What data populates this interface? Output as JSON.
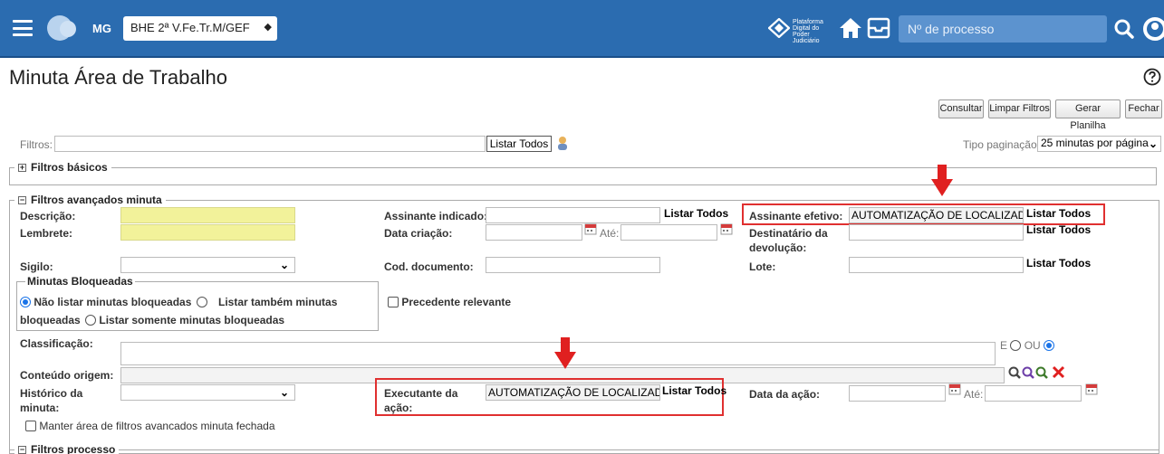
{
  "header": {
    "uf": "MG",
    "orgao_select": "BHE 2ª V.Fe.Tr.M/GEF",
    "logo_text": [
      "Plataforma",
      "Digital do",
      "Poder Judiciário"
    ],
    "search_placeholder": "Nº de processo",
    "icons": [
      "menu-icon",
      "avatar-icon",
      "pdpj-logo-icon",
      "home-icon",
      "inbox-icon",
      "search-icon",
      "user-icon"
    ]
  },
  "page": {
    "title": "Minuta Área de Trabalho"
  },
  "toolbar": {
    "consultar": "Consultar",
    "limpar": "Limpar Filtros",
    "gerar": "Gerar Planilha",
    "fechar": "Fechar"
  },
  "filters": {
    "label": "Filtros:",
    "listar_todos": "Listar Todos",
    "tipo_paginacao_label": "Tipo paginação:",
    "tipo_paginacao_value": "25 minutas por página"
  },
  "basic": {
    "legend": "Filtros básicos"
  },
  "advanced": {
    "legend": "Filtros avançados minuta",
    "descricao": "Descrição:",
    "lembrete": "Lembrete:",
    "sigilo": "Sigilo:",
    "assinante_indicado": "Assinante indicado:",
    "data_criacao": "Data criação:",
    "ate": "Até:",
    "cod_documento": "Cod. documento:",
    "assinante_efetivo": "Assinante efetivo:",
    "assinante_efetivo_value": "AUTOMATIZAÇÃO DE LOCALIZADC",
    "destinatario": "Destinatário da devolução:",
    "lote": "Lote:",
    "listar_todos": "Listar Todos",
    "bloqueadas_legend": "Minutas Bloqueadas",
    "radio_nao_listar": "Não listar minutas bloqueadas",
    "radio_listar_tambem": "Listar também minutas bloqueadas",
    "radio_listar_somente": "Listar somente minutas bloqueadas",
    "precedente": "Precedente relevante",
    "classificacao": "Classificação:",
    "e_label": "E",
    "ou_label": "OU",
    "conteudo_origem": "Conteúdo origem:",
    "historico": "Histórico da minuta:",
    "executante": "Executante da ação:",
    "executante_value": "AUTOMATIZAÇÃO DE LOCALIZADC",
    "data_acao": "Data da ação:",
    "manter": "Manter área de filtros avancados minuta fechada"
  },
  "processo": {
    "legend": "Filtros processo"
  },
  "colors": {
    "header": "#2b6cb0",
    "highlight": "#e03030",
    "yellow_input": "#f2f29a",
    "radio": "#1a73e8"
  }
}
